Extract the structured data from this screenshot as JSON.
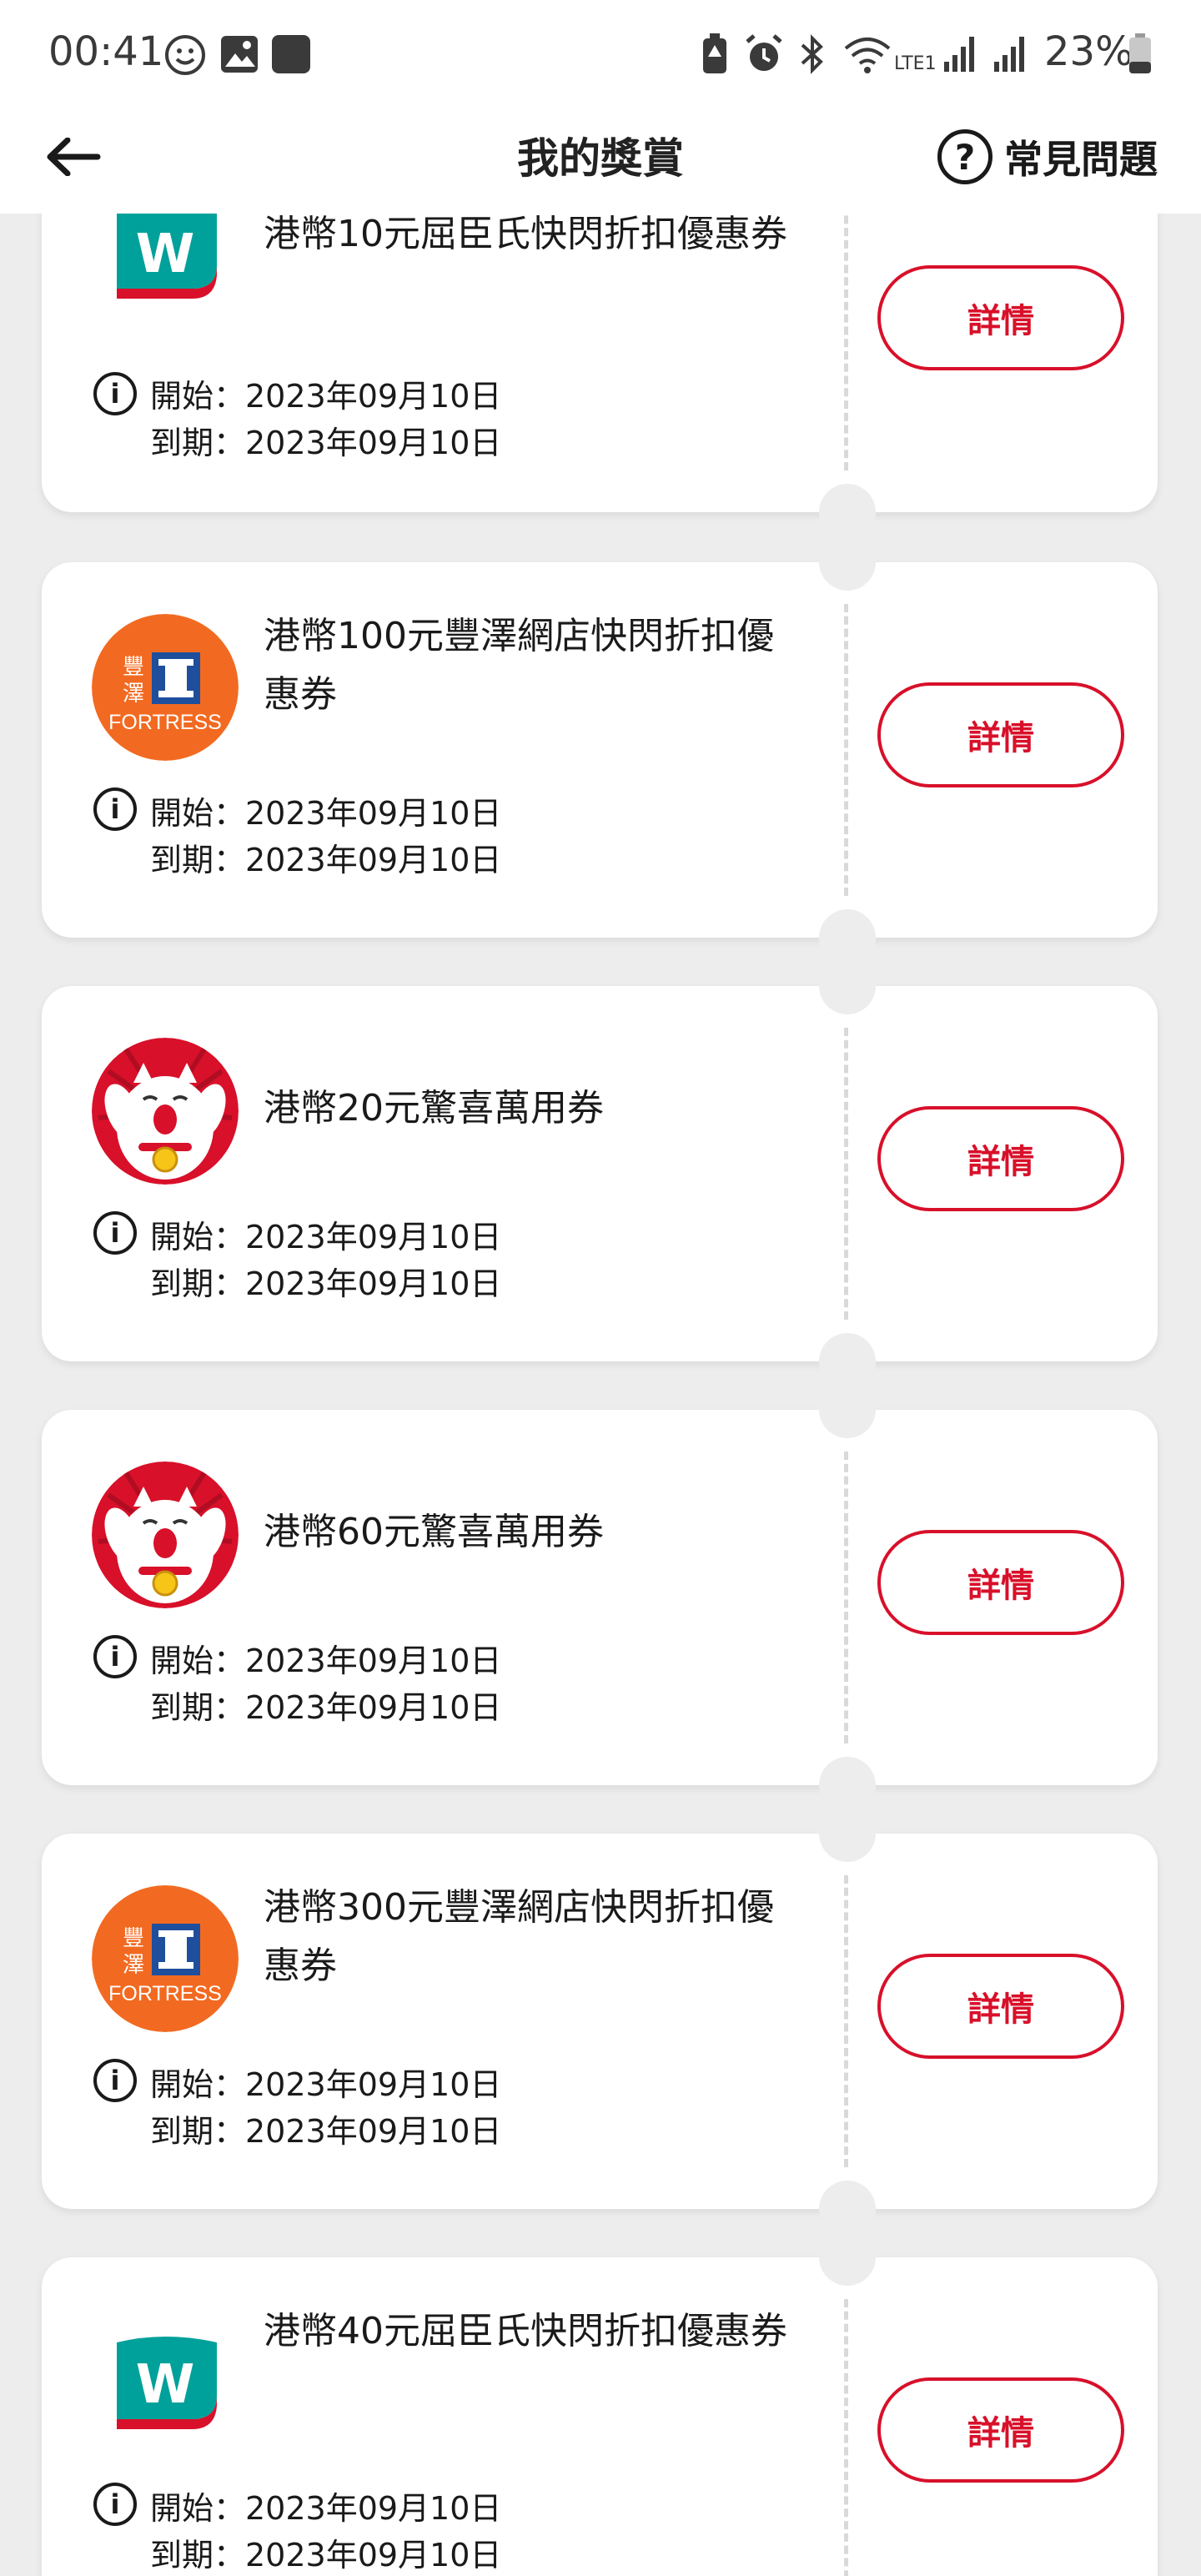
{
  "status_bar": {
    "time": "00:41",
    "battery": "23%",
    "signal_label": "LTE1"
  },
  "header": {
    "title": "我的獎賞",
    "faq_label": "常見問題",
    "faq_icon": "?"
  },
  "brand_texts": {
    "watsons_letter": "W",
    "fortress_char_1": "豐",
    "fortress_char_2": "澤",
    "fortress_name": "FORTRESS"
  },
  "coupons": [
    {
      "title": "港幣10元屈臣氏快閃折扣優惠券",
      "logo": "watsons-logo",
      "start": "開始：2023年09月10日",
      "end": "到期：2023年09月10日",
      "button": "詳情"
    },
    {
      "title": "港幣100元豐澤網店快閃折扣優惠券",
      "logo": "fortress-logo",
      "start": "開始：2023年09月10日",
      "end": "到期：2023年09月10日",
      "button": "詳情"
    },
    {
      "title": "港幣20元驚喜萬用券",
      "logo": "lucky-cat-logo",
      "start": "開始：2023年09月10日",
      "end": "到期：2023年09月10日",
      "button": "詳情"
    },
    {
      "title": "港幣60元驚喜萬用券",
      "logo": "lucky-cat-logo",
      "start": "開始：2023年09月10日",
      "end": "到期：2023年09月10日",
      "button": "詳情"
    },
    {
      "title": "港幣300元豐澤網店快閃折扣優惠券",
      "logo": "fortress-logo",
      "start": "開始：2023年09月10日",
      "end": "到期：2023年09月10日",
      "button": "詳情"
    },
    {
      "title": "港幣40元屈臣氏快閃折扣優惠券",
      "logo": "watsons-logo",
      "start": "開始：2023年09月10日",
      "end": "到期：2023年09月10日",
      "button": "詳情"
    }
  ],
  "colors": {
    "accent": "#d8102a",
    "watsons_teal": "#00a19a",
    "fortress_orange": "#f26a21",
    "fortress_blue": "#1f4e9c",
    "cat_red": "#d8102a"
  }
}
